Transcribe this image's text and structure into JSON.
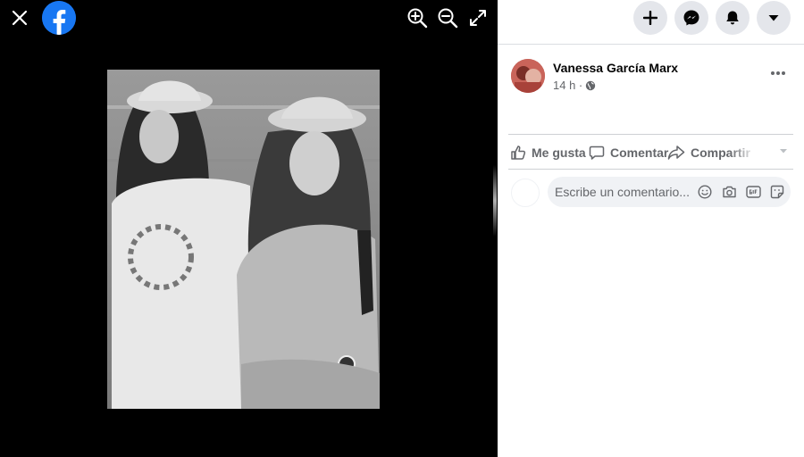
{
  "viewer": {
    "close_icon": "close-icon",
    "logo_icon": "facebook-logo-icon",
    "tools": [
      "zoom-in-icon",
      "zoom-out-icon",
      "fullscreen-icon"
    ],
    "photo_description_icon": "black-and-white-photo"
  },
  "topbar": {
    "buttons": [
      "plus-icon",
      "messenger-icon",
      "bell-icon",
      "caret-down-icon"
    ]
  },
  "post": {
    "author": "Vanessa García Marx",
    "time": "14 h ·",
    "privacy_icon": "globe-icon"
  },
  "actions": {
    "like_label": "Me gusta",
    "comment_label": "Comentar",
    "share_label": "Compartir"
  },
  "comment": {
    "placeholder": "Escribe un comentario...",
    "icons": [
      "emoji-icon",
      "camera-icon",
      "gif-icon",
      "sticker-icon"
    ]
  },
  "colors": {
    "brand": "#1877f2",
    "panel_bg": "#ffffff",
    "viewer_bg": "#000000",
    "muted_text": "#65676b"
  }
}
